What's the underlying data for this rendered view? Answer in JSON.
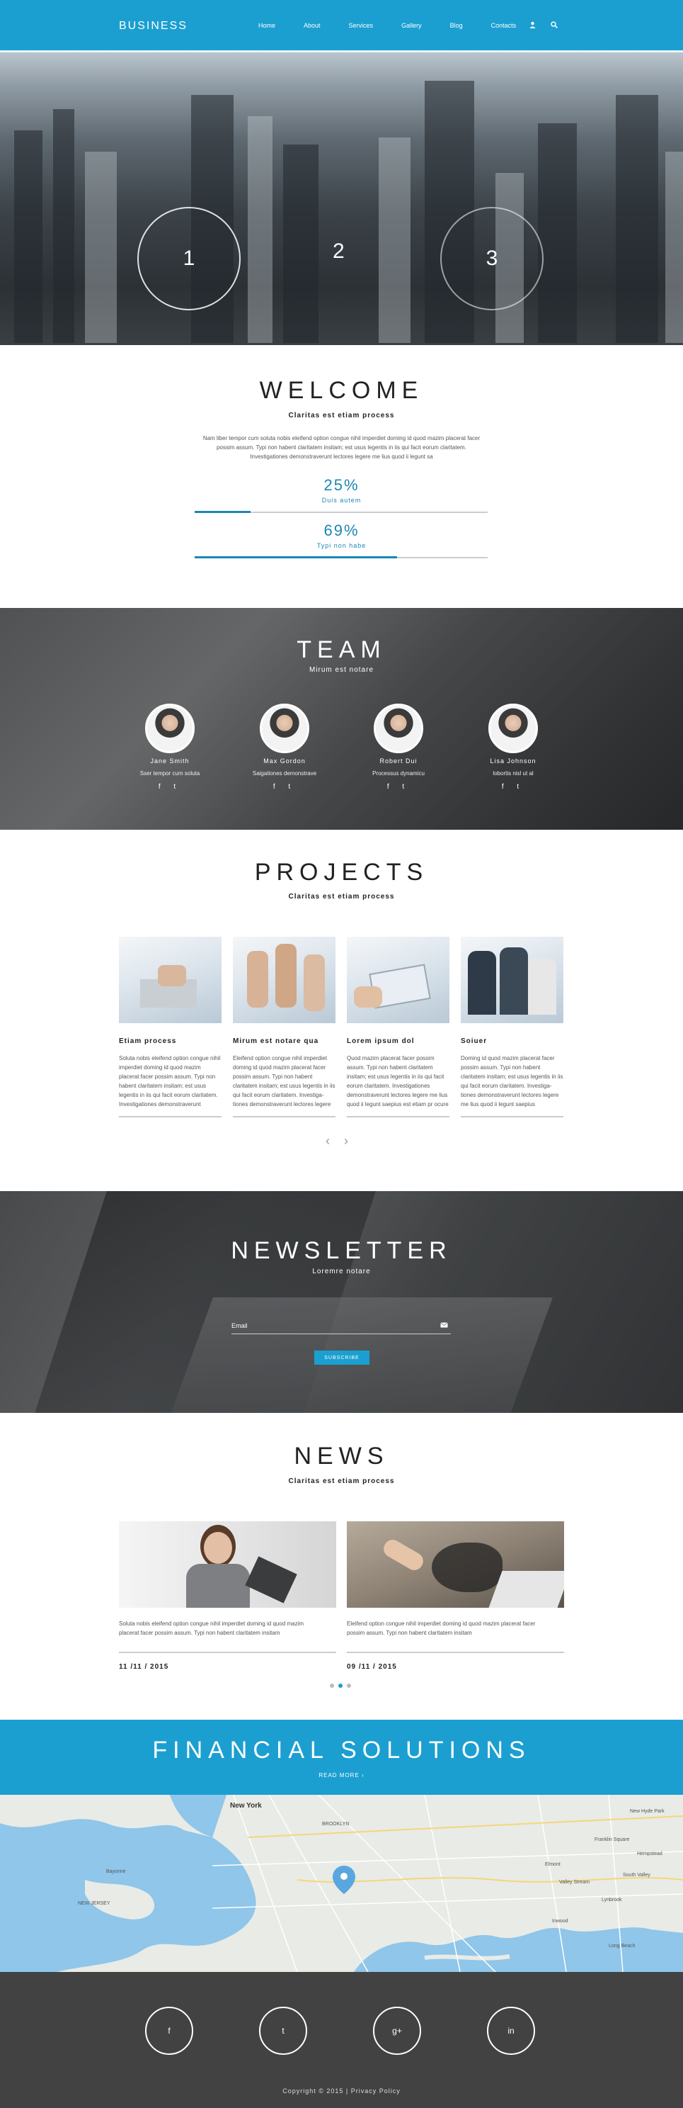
{
  "header": {
    "logo": "BUSINESS",
    "nav": [
      "Home",
      "About",
      "Services",
      "Gallery",
      "Blog",
      "Contacts"
    ],
    "user_icon": "user-icon",
    "search_icon": "search-icon"
  },
  "hero": {
    "slides": [
      "1",
      "2",
      "3"
    ]
  },
  "welcome": {
    "title": "WELCOME",
    "subtitle": "Claritas est etiam process",
    "text": "Nam liber tempor cum soluta nobis eleifend option congue nihil imperdiet doming id quod mazim placerat facer possim assum. Typi non habent claritatem insitam; est usus legentis in iis qui facit eorum claritatem. Investigationes demonstraverunt lectores legere me lius quod ii legunt sa",
    "stats": [
      {
        "value": "25%",
        "label": "Duis autem",
        "fraction": 0.19
      },
      {
        "value": "69%",
        "label": "Typi non habe",
        "fraction": 0.69
      }
    ]
  },
  "team": {
    "title": "TEAM",
    "subtitle": "Mirum est notare",
    "members": [
      {
        "name": "Jane Smith",
        "role": "Sser tempor cum soluta"
      },
      {
        "name": "Max Gordon",
        "role": "Saigationes demonstrave"
      },
      {
        "name": "Robert Dui",
        "role": "Processus dynamicu"
      },
      {
        "name": "Lisa Johnson",
        "role": "lobortis nisl ut al"
      }
    ],
    "social": "f  t"
  },
  "projects": {
    "title": "PROJECTS",
    "subtitle": "Claritas est etiam process",
    "items": [
      {
        "title": "Etiam process",
        "text": "Soluta nobis eleifend option congue nihil imperdiet doming id quod mazim placerat facer possim assum. Typi non habent claritatem insitam; est usus legentis in iis qui facit eorum claritatem. Investigationes demonstraverunt"
      },
      {
        "title": "Mirum est notare qua",
        "text": "Eleifend option congue nihil imperdiet doming id quod mazim placerat facer possim assum. Typi non habent claritatem insitam; est usus legentis in iis qui facit eorum claritatem. Investiga-tiones demonstraverunt lectores legere"
      },
      {
        "title": "Lorem ipsum dol",
        "text": "Quod mazim placerat facer possim assum. Typi non habent claritatem insitam; est usus legentis in iis qui facit eorum claritatem. Investigationes demonstraverunt lectores legere me lius quod ii legunt saepius est etiam pr ocure"
      },
      {
        "title": "Soiuer",
        "text": "Doming id quod mazim placerat facer possim assum. Typi non habent claritatem insitam; est usus legentis in iis qui facit eorum claritatem. Investiga-tiones demonstraverunt lectores legere me lius quod ii legunt saepius"
      }
    ],
    "prev": "‹",
    "next": "›"
  },
  "newsletter": {
    "title": "NEWSLETTER",
    "subtitle": "Loremre notare",
    "email_placeholder": "Email",
    "button": "SUBSCRIBE"
  },
  "news": {
    "title": "NEWS",
    "subtitle": "Claritas est etiam process",
    "items": [
      {
        "text": "Soluta nobis eleifend option congue nihil imperdiet doming id quod mazim placerat facer possim assum. Typi non habent claritatem insitam",
        "date": "11 /11 / 2015"
      },
      {
        "text": "Eleifend option congue nihil imperdiet doming id quod mazim placerat facer possim assum. Typi non habent claritatem insitam",
        "date": "09 /11 / 2015"
      }
    ]
  },
  "financial": {
    "title": "FINANCIAL SOLUTIONS",
    "button": "READ MORE  ›"
  },
  "map": {
    "labels": [
      "New York",
      "BROOKLYN",
      "Valley Stream",
      "Franklin Square",
      "Lynbrook",
      "Inwood",
      "Long Beach",
      "Elmont",
      "South Valley",
      "New Hyde Park",
      "Bayonne",
      "NEW JERSEY",
      "Hempstead"
    ]
  },
  "footer": {
    "social": [
      "f",
      "t",
      "g+",
      "in"
    ],
    "copyright": "Copyright © 2015 |",
    "privacy": "Privacy Policy"
  },
  "colors": {
    "accent": "#1b9fd0",
    "footer": "#424242"
  }
}
